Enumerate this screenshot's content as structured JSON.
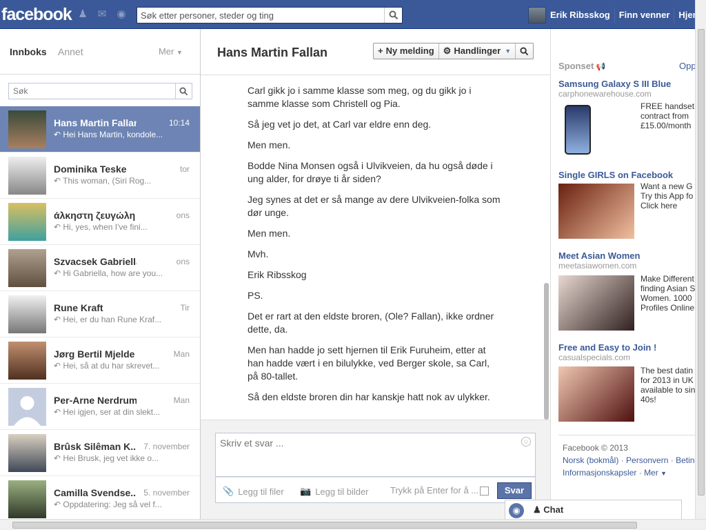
{
  "topbar": {
    "logo": "facebook",
    "search_placeholder": "Søk etter personer, steder og ting",
    "user_name": "Erik Ribsskog",
    "nav_find_friends": "Finn venner",
    "nav_home": "Hjem"
  },
  "inbox": {
    "title": "Innboks",
    "other": "Annet",
    "more": "Mer",
    "search_placeholder": "Søk",
    "threads": [
      {
        "name": "Hans Martin Fallan",
        "time": "10:14",
        "snippet": "Hei Hans Martin, kondole..."
      },
      {
        "name": "Dominika Teske",
        "time": "tor",
        "snippet": "This woman, (Siri Rog..."
      },
      {
        "name": "άλκηστη ζευγώλη",
        "time": "ons",
        "snippet": "Hi, yes, when I've fini..."
      },
      {
        "name": "Szvacsek Gabriella",
        "time": "ons",
        "snippet": "Hi Gabriella, how are you..."
      },
      {
        "name": "Rune Kraft",
        "time": "Tir",
        "snippet": "Hei, er du han Rune Kraf..."
      },
      {
        "name": "Jørg Bertil Mjelde",
        "time": "Man",
        "snippet": "Hei, så at du har skrevet..."
      },
      {
        "name": "Per-Arne Nerdrum",
        "time": "Man",
        "snippet": "Hei igjen, ser at din slekt..."
      },
      {
        "name": "Brûsk Silêman K...",
        "time": "7. november",
        "snippet": "Hei Brusk, jeg vet ikke o..."
      },
      {
        "name": "Camilla Svendse...",
        "time": "5. november",
        "snippet": "Oppdatering: Jeg så vel f..."
      }
    ]
  },
  "conversation": {
    "title": "Hans Martin Fallan",
    "new_message": "Ny melding",
    "actions": "Handlinger",
    "messages": [
      "Carl gikk jo i samme klasse som meg, og du gikk jo i samme klasse som Christell og Pia.",
      "Så jeg vet jo det, at Carl var eldre enn deg.",
      "Men men.",
      "Bodde Nina Monsen også i Ulvikveien, da hu også døde i ung alder, for drøye ti år siden?",
      "Jeg synes at det er så mange av dere Ulvikveien-folka som dør unge.",
      "Men men.",
      "Mvh.",
      "Erik Ribsskog",
      "PS.",
      "Det er rart at den eldste broren, (Ole? Fallan), ikke ordner dette, da.",
      "Men han hadde jo sett hjernen til Erik Furuheim, etter at han hadde vært i en bilulykke, ved Berger skole, sa Carl, på 80-tallet.",
      "Så den eldste broren din har kanskje hatt nok av ulykker."
    ]
  },
  "composer": {
    "placeholder": "Skriv et svar ...",
    "add_files": "Legg til filer",
    "add_photos": "Legg til bilder",
    "enter_hint": "Trykk på Enter for å ...",
    "send": "Svar"
  },
  "ads": {
    "sponsored": "Sponset",
    "create": "Opprett",
    "items": [
      {
        "title": "Samsung Galaxy S III Blue",
        "domain": "carphonewarehouse.com",
        "text": [
          "FREE handset",
          "contract from",
          "£15.00/month"
        ]
      },
      {
        "title": "Single GIRLS on Facebook",
        "domain": "",
        "text": [
          "Want a new G",
          "Try this App fo",
          "Click here"
        ]
      },
      {
        "title": "Meet Asian Women",
        "domain": "meetasiawomen.com",
        "text": [
          "Make Different",
          "finding Asian S",
          "Women. 1000",
          "Profiles Online"
        ]
      },
      {
        "title": "Free and Easy to Join !",
        "domain": "casualspecials.com",
        "text": [
          "The best datin",
          "for 2013 in UK",
          "available to sin",
          "40s!"
        ]
      }
    ],
    "footer_copyright": "Facebook © 2013",
    "footer_lang": "Norsk (bokmål)",
    "footer_privacy": "Personvern",
    "footer_terms": "Betingelser",
    "footer_cookies": "Informasjonskapsler",
    "footer_more": "Mer"
  },
  "chat": {
    "label": "Chat"
  }
}
